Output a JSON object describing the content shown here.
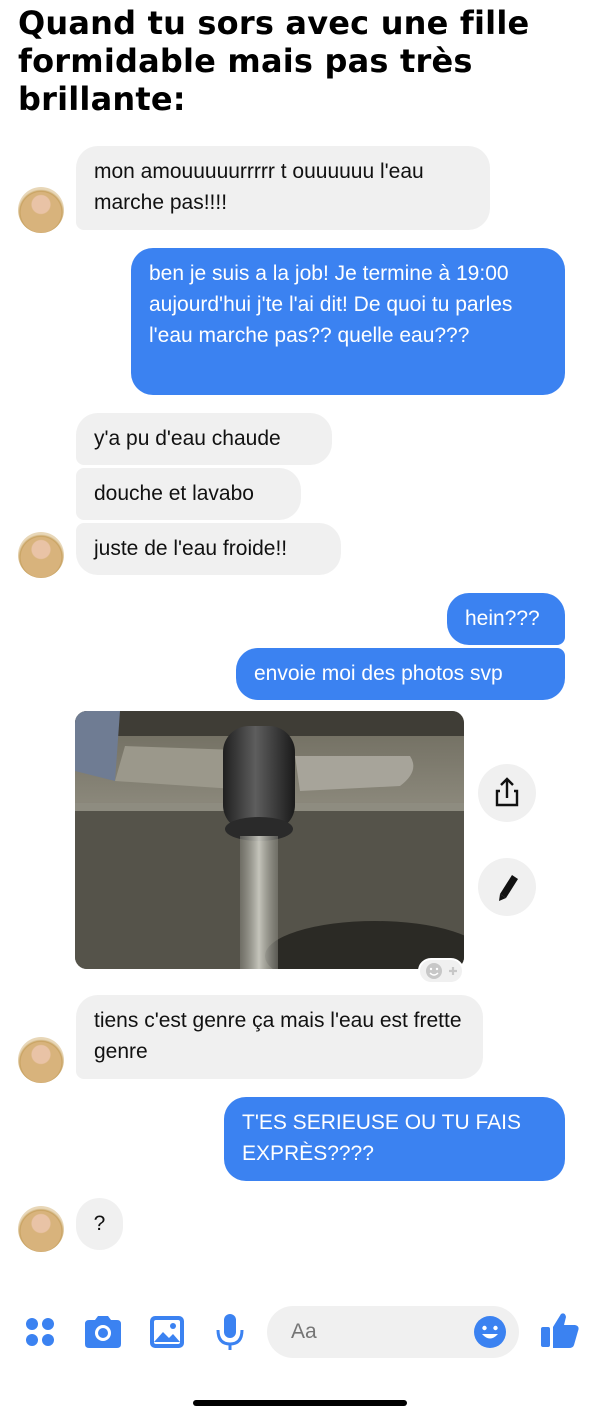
{
  "meme": {
    "title": "Quand tu sors avec une fille formidable mais pas très brillante:"
  },
  "messages": [
    {
      "side": "received",
      "text": "mon amouuuuurrrrr t ouuuuuu l'eau marche pas!!!!"
    },
    {
      "side": "sent",
      "text": "ben je suis a la job! Je termine à 19:00 aujourd'hui j'te l'ai dit! De quoi tu parles l'eau marche pas?? quelle eau???"
    },
    {
      "side": "received",
      "text": "y'a pu d'eau chaude"
    },
    {
      "side": "received",
      "text": "douche et lavabo"
    },
    {
      "side": "received",
      "text": "juste de l'eau froide!!"
    },
    {
      "side": "sent",
      "text": "hein???"
    },
    {
      "side": "sent",
      "text": "envoie moi des photos svp"
    },
    {
      "side": "received",
      "type": "photo",
      "subject": "faucet-running-water"
    },
    {
      "side": "received",
      "text": "tiens c'est genre ça mais l'eau est frette genre"
    },
    {
      "side": "sent",
      "text": "T'ES SERIEUSE OU TU FAIS EXPRÈS????"
    },
    {
      "side": "received",
      "text": "?"
    }
  ],
  "photo_actions": {
    "share_icon": "share-icon",
    "edit_icon": "pencil-icon",
    "reaction_icon": "add-reaction-icon"
  },
  "composer": {
    "placeholder": "Aa",
    "icons": [
      "apps-icon",
      "camera-icon",
      "gallery-icon",
      "microphone-icon",
      "emoji-icon",
      "thumbs-up-icon"
    ]
  },
  "colors": {
    "accent": "#3b82f1",
    "received_bubble": "#f0f0f0",
    "sent_text": "#ffffff"
  }
}
